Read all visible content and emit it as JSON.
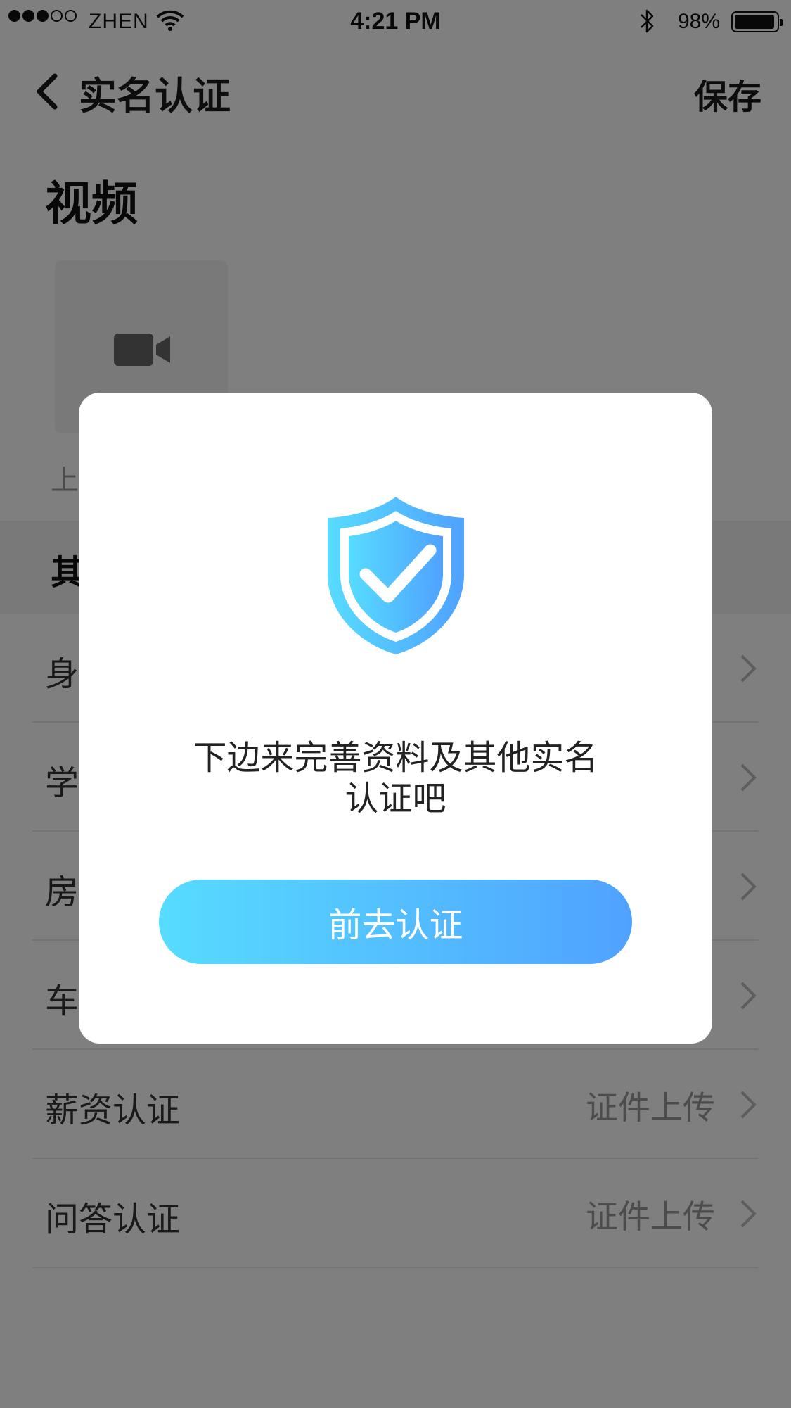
{
  "status_bar": {
    "signal_bars_filled": 3,
    "signal_bars_total": 5,
    "carrier": "ZHEN",
    "time": "4:21 PM",
    "battery_percent_text": "98%",
    "battery_level": 0.98,
    "icons": [
      "wifi-icon",
      "bluetooth-icon",
      "battery-icon"
    ]
  },
  "nav": {
    "back_icon": "chevron-left-icon",
    "title": "实名认证",
    "save_label": "保存"
  },
  "video_section": {
    "title": "视频",
    "upload_icon": "video-camera-icon",
    "caption": "上"
  },
  "other_section": {
    "title": "其"
  },
  "list": {
    "rows": [
      {
        "label": "身",
        "value": ""
      },
      {
        "label": "学",
        "value": ""
      },
      {
        "label": "房",
        "value": ""
      },
      {
        "label": "车",
        "value": ""
      },
      {
        "label": "薪资认证",
        "value": "证件上传"
      },
      {
        "label": "问答认证",
        "value": "证件上传"
      }
    ],
    "row_chevron_icon": "chevron-right-icon"
  },
  "modal": {
    "icon": "shield-check-icon",
    "message_line1": "下边来完善资料及其他实名",
    "message_line2": "认证吧",
    "button_label": "前去认证"
  },
  "colors": {
    "overlay": "rgba(0,0,0,0.5)",
    "gradient_start": "#57dcff",
    "gradient_end": "#50a2ff",
    "text_primary": "#222222",
    "text_secondary": "#999999"
  }
}
